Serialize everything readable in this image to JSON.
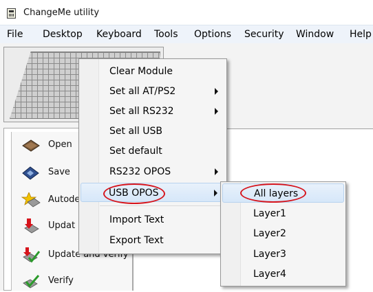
{
  "window": {
    "title": "ChangeMe utility"
  },
  "menubar": {
    "items": [
      "File",
      "Desktop",
      "Keyboard",
      "Tools",
      "Options",
      "Security",
      "Window",
      "Help"
    ]
  },
  "toolbar": {
    "items": [
      {
        "label": "Open",
        "icon": "folder-open-icon"
      },
      {
        "label": "Save",
        "icon": "diskette-save-icon"
      },
      {
        "label": "Autode",
        "icon": "autodetect-star-icon"
      },
      {
        "label": "Updat",
        "icon": "update-arrow-icon"
      },
      {
        "label": "Update and verify",
        "icon": "update-verify-icon"
      },
      {
        "label": "Verify",
        "icon": "verify-check-icon"
      }
    ]
  },
  "context_menu": {
    "items": [
      {
        "label": "Clear Module",
        "submenu": false
      },
      {
        "label": "Set all AT/PS2",
        "submenu": true
      },
      {
        "label": "Set all RS232",
        "submenu": true
      },
      {
        "label": "Set all USB",
        "submenu": false
      },
      {
        "label": "Set default",
        "submenu": false
      },
      {
        "label": "RS232 OPOS",
        "submenu": true
      },
      {
        "label": "USB OPOS",
        "submenu": true,
        "highlighted": true
      },
      {
        "label": "Import Text",
        "submenu": false
      },
      {
        "label": "Export Text",
        "submenu": false
      }
    ]
  },
  "submenu": {
    "items": [
      {
        "label": "All layers",
        "highlighted": true
      },
      {
        "label": "Layer1"
      },
      {
        "label": "Layer2"
      },
      {
        "label": "Layer3"
      },
      {
        "label": "Layer4"
      }
    ]
  },
  "colors": {
    "menubar_bg": "#eef3fa",
    "highlight_bg": "#d6e7f9",
    "annotation_red": "#d6141c"
  }
}
